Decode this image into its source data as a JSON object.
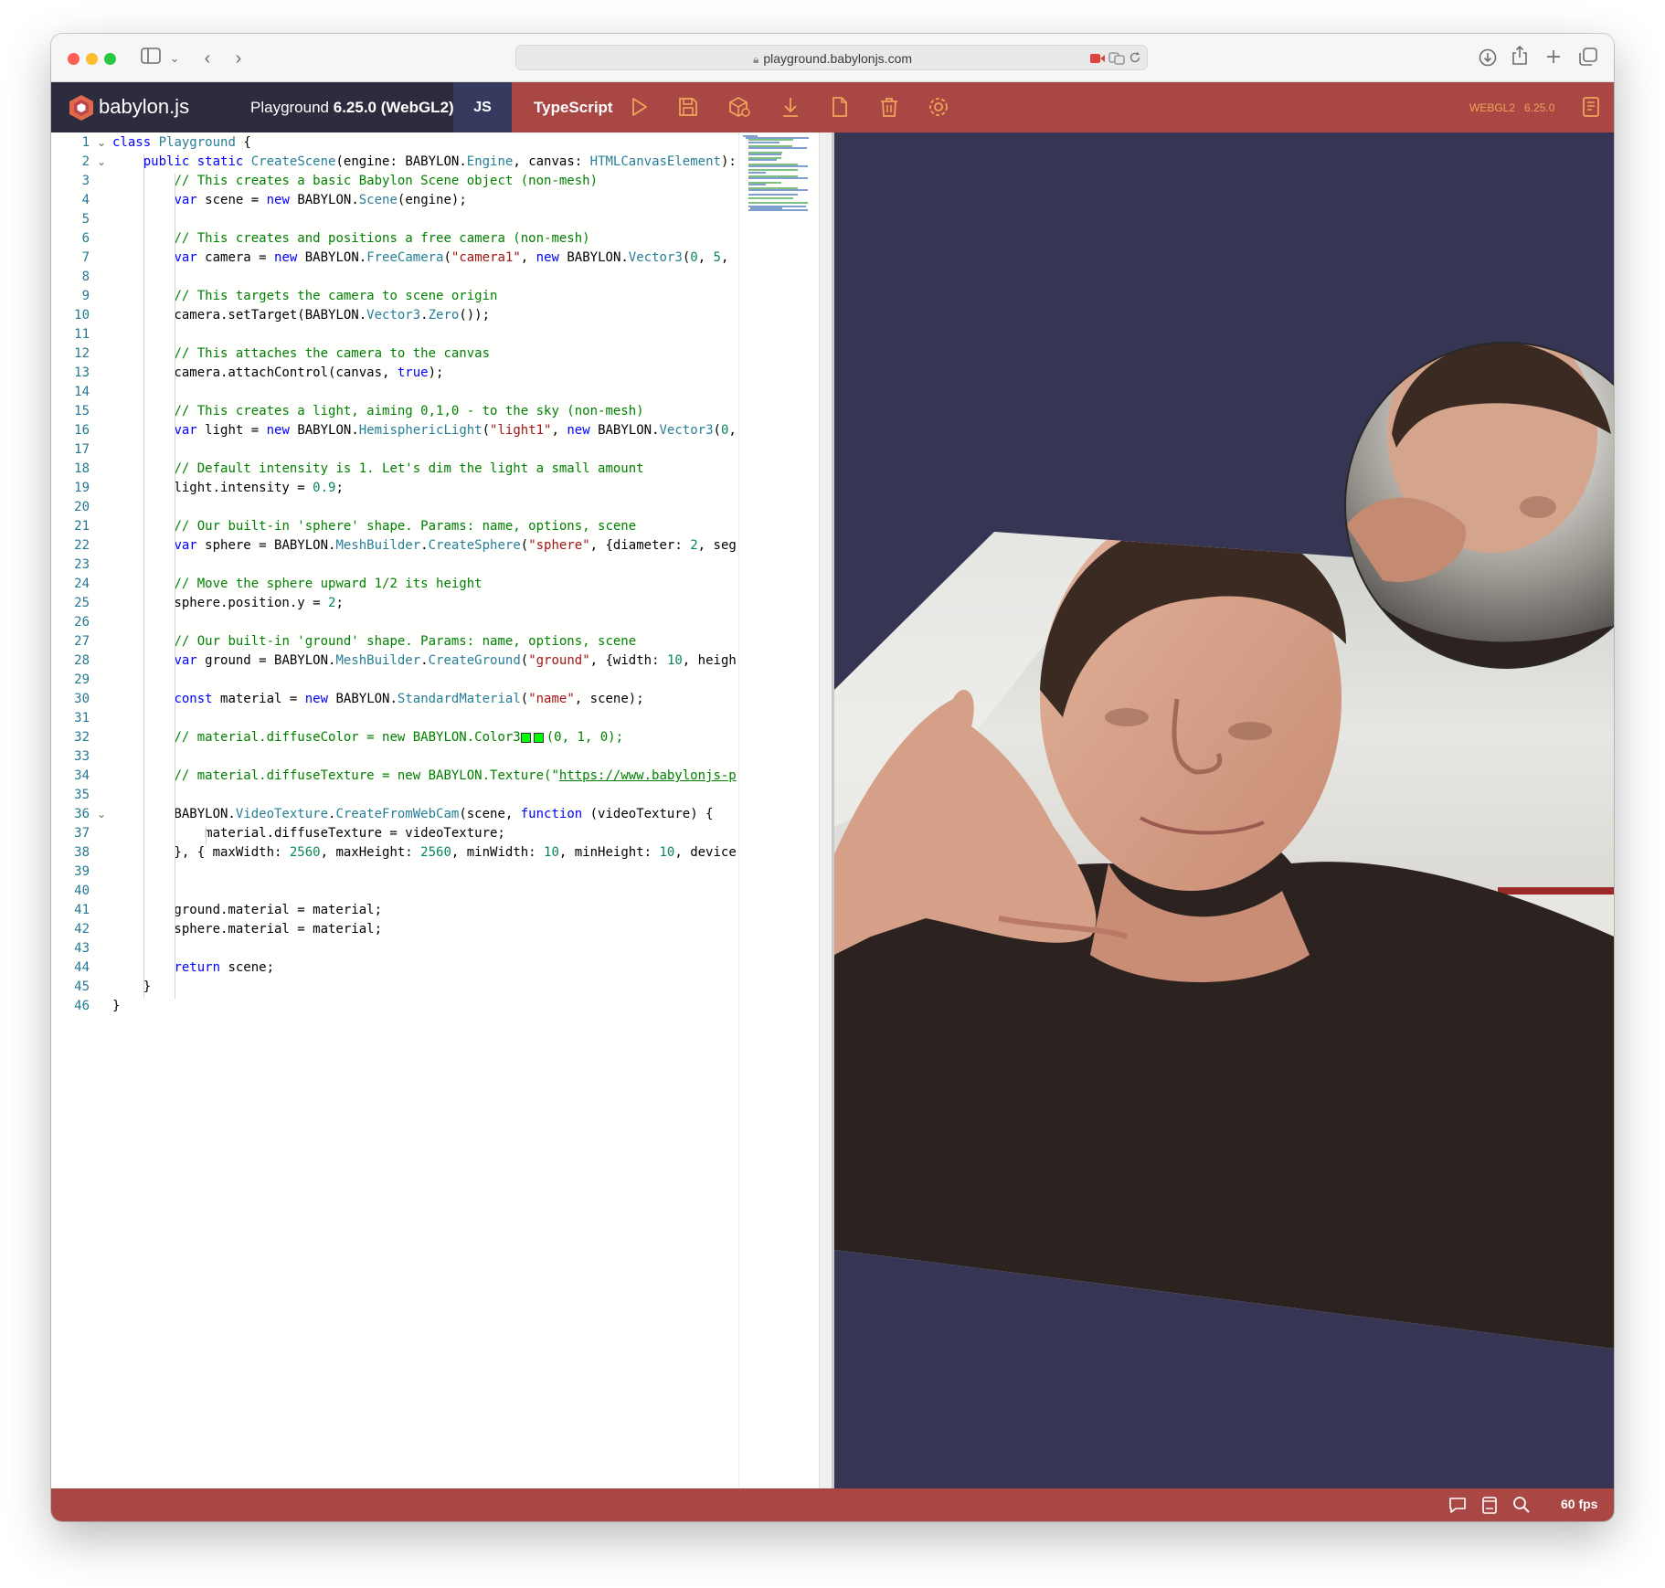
{
  "browser": {
    "url": "playground.babylonjs.com"
  },
  "header": {
    "logo_text": "babylon.js",
    "title_prefix": "Playground ",
    "title_version": "6.25.0 (WebGL2)",
    "tab_js": "JS",
    "tab_ts": "TypeScript",
    "engine_label": "WEBGL2",
    "version_label": "6.25.0",
    "icons": [
      "run-icon",
      "save-icon",
      "inspector-icon",
      "download-icon",
      "new-icon",
      "clear-icon",
      "settings-icon"
    ],
    "accent_color": "#a94745",
    "dark_color": "#2c2c3e",
    "label_color": "#f0a35a"
  },
  "editor": {
    "line_numbers": [
      "1",
      "2",
      "3",
      "4",
      "5",
      "6",
      "7",
      "8",
      "9",
      "10",
      "11",
      "12",
      "13",
      "14",
      "15",
      "16",
      "17",
      "18",
      "19",
      "20",
      "21",
      "22",
      "23",
      "24",
      "25",
      "26",
      "27",
      "28",
      "29",
      "30",
      "31",
      "32",
      "33",
      "34",
      "35",
      "36",
      "37",
      "38",
      "39",
      "40",
      "41",
      "42",
      "43",
      "44",
      "45",
      "46"
    ],
    "lines": [
      "class Playground {",
      "    public static CreateScene(engine: BABYLON.Engine, canvas: HTMLCanvasElement):",
      "        // This creates a basic Babylon Scene object (non-mesh)",
      "        var scene = new BABYLON.Scene(engine);",
      "",
      "        // This creates and positions a free camera (non-mesh)",
      "        var camera = new BABYLON.FreeCamera(\"camera1\", new BABYLON.Vector3(0, 5,",
      "",
      "        // This targets the camera to scene origin",
      "        camera.setTarget(BABYLON.Vector3.Zero());",
      "",
      "        // This attaches the camera to the canvas",
      "        camera.attachControl(canvas, true);",
      "",
      "        // This creates a light, aiming 0,1,0 - to the sky (non-mesh)",
      "        var light = new BABYLON.HemisphericLight(\"light1\", new BABYLON.Vector3(0,",
      "",
      "        // Default intensity is 1. Let's dim the light a small amount",
      "        light.intensity = 0.9;",
      "",
      "        // Our built-in 'sphere' shape. Params: name, options, scene",
      "        var sphere = BABYLON.MeshBuilder.CreateSphere(\"sphere\", {diameter: 2, seg",
      "",
      "        // Move the sphere upward 1/2 its height",
      "        sphere.position.y = 2;",
      "",
      "        // Our built-in 'ground' shape. Params: name, options, scene",
      "        var ground = BABYLON.MeshBuilder.CreateGround(\"ground\", {width: 10, heigh",
      "",
      "        const material = new BABYLON.StandardMaterial(\"name\", scene);",
      "",
      "        // material.diffuseColor = new BABYLON.Color3(0, 1, 0);",
      "",
      "        // material.diffuseTexture = new BABYLON.Texture(\"https://www.babylonjs-p",
      "",
      "        BABYLON.VideoTexture.CreateFromWebCam(scene, function (videoTexture) {",
      "            material.diffuseTexture = videoTexture;",
      "        }, { maxWidth: 2560, maxHeight: 2560, minWidth: 10, minHeight: 10, device",
      "",
      "",
      "        ground.material = material;",
      "        sphere.material = material;",
      "",
      "        return scene;",
      "    }",
      "}"
    ]
  },
  "footer": {
    "fps": "60 fps",
    "icons": [
      "feedback-icon",
      "docs-icon",
      "search-icon"
    ]
  }
}
